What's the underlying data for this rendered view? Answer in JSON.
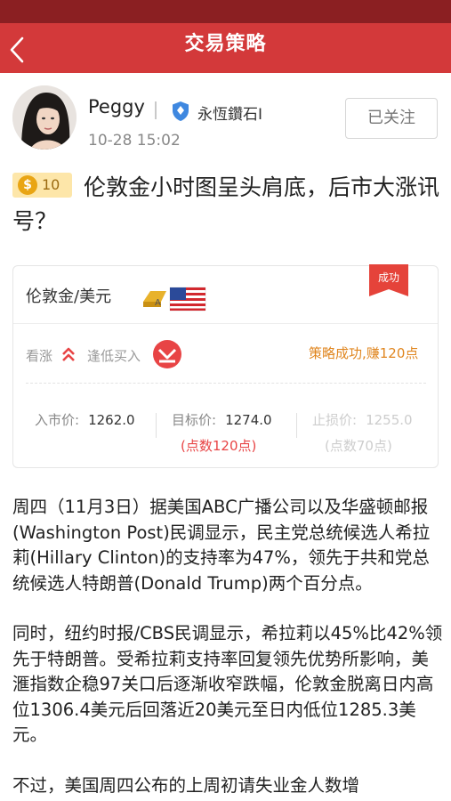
{
  "header": {
    "title": "交易策略"
  },
  "author": {
    "name": "Peggy",
    "rank": "永恆鑽石I",
    "time": "10-28 15:02",
    "follow_label": "已关注"
  },
  "post": {
    "coin_count": "10",
    "coin_symbol": "$",
    "title": "伦敦金小时图呈头肩底，后市大涨讯号？"
  },
  "strategy": {
    "pair": "伦敦金/美元",
    "status": "成功",
    "direction": "看涨",
    "order_type": "逢低买入",
    "result": "策略成功,赚120点",
    "entry_label": "入市价:",
    "entry_value": "1262.0",
    "target_label": "目标价:",
    "target_value": "1274.0",
    "target_points": "(点数120点)",
    "stop_label": "止损价:",
    "stop_value": "1255.0",
    "stop_points": "(点数70点)",
    "colors": {
      "header_red": "#d3393a",
      "status_bar": "#8b1f22",
      "accent_orange": "#e0861f",
      "up_red": "#e84445"
    },
    "icons": [
      "chevron-left-icon",
      "shield-icon",
      "coin-icon",
      "gold-usd-flag-icon",
      "double-chevron-up-icon",
      "buy-down-arrow-icon"
    ]
  },
  "article": {
    "paragraphs": [
      "周四（11月3日）据美国ABC广播公司以及华盛顿邮报(Washington Post)民调显示，民主党总统候选人希拉莉(Hillary Clinton)的支持率为47%，领先于共和党总统候选人特朗普(Donald Trump)两个百分点。",
      "同时，纽约时报/CBS民调显示，希拉莉以45%比42%领先于特朗普。受希拉莉支持率回复领先优势所影响，美滙指数企稳97关口后逐渐收窄跌幅，伦敦金脱离日内高位1306.4美元后回落近20美元至日内低位1285.3美元。",
      "不过，美国周四公布的上周初请失业金人数增"
    ]
  }
}
